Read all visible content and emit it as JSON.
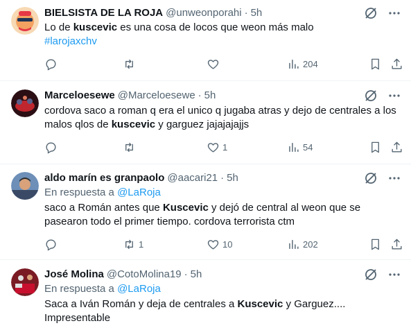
{
  "tweets": [
    {
      "name": "BIELSISTA DE LA ROJA",
      "handle": "@unweonporahi",
      "time": "5h",
      "reply_prefix": "",
      "reply_handle": "",
      "text_parts": [
        "Lo de ",
        "kuscevic",
        " es una cosa de locos que weon más malo"
      ],
      "hashtag": "#larojaxchv",
      "stats": {
        "replies": "",
        "retweets": "",
        "likes": "",
        "views": "204"
      },
      "avatar_colors": [
        "#f4a261",
        "#e63946",
        "#1d3557"
      ]
    },
    {
      "name": "Marceloesewe",
      "handle": "@Marceloesewe",
      "time": "5h",
      "reply_prefix": "",
      "reply_handle": "",
      "text_line1": "cordova saco a roman q era el unico q jugaba atras y dejo de centrales a los",
      "text_parts": [
        "malos qlos de ",
        "kuscevic",
        " y garguez jajajajajjs"
      ],
      "stats": {
        "replies": "",
        "retweets": "",
        "likes": "1",
        "views": "54"
      },
      "avatar_colors": [
        "#2b0f14",
        "#c0262d",
        "#5a5f8a"
      ]
    },
    {
      "name": "aldo marín es granpaolo",
      "handle": "@aacari21",
      "time": "5h",
      "reply_prefix": "En respuesta a ",
      "reply_handle": "@LaRoja",
      "text_parts": [
        "saco a Román antes que ",
        "Kuscevic",
        " y dejó de central al weon que se"
      ],
      "text_line2": "pasearon todo el primer tiempo. cordova terrorista ctm",
      "stats": {
        "replies": "",
        "retweets": "1",
        "likes": "10",
        "views": "202"
      },
      "avatar_colors": [
        "#6d8fb8",
        "#3a4a66",
        "#d9a27a"
      ]
    },
    {
      "name": "José Molina",
      "handle": "@CotoMolina19",
      "time": "5h",
      "reply_prefix": "En respuesta a ",
      "reply_handle": "@LaRoja",
      "text_parts": [
        "Saca a Iván Román y deja de centrales a ",
        "Kuscevic",
        " y Garguez...."
      ],
      "text_line2": "Impresentable",
      "avatar_colors": [
        "#7a1b24",
        "#e0e0e0",
        "#c8102e"
      ]
    }
  ],
  "icons": {
    "grok": "grok-icon",
    "more": "more-icon",
    "reply": "reply-icon",
    "retweet": "retweet-icon",
    "like": "like-icon",
    "views": "views-icon",
    "bookmark": "bookmark-icon",
    "share": "share-icon"
  },
  "colors": {
    "link": "#1d9bf0",
    "muted": "#536471",
    "text": "#0f1419",
    "border": "#eff3f4"
  }
}
